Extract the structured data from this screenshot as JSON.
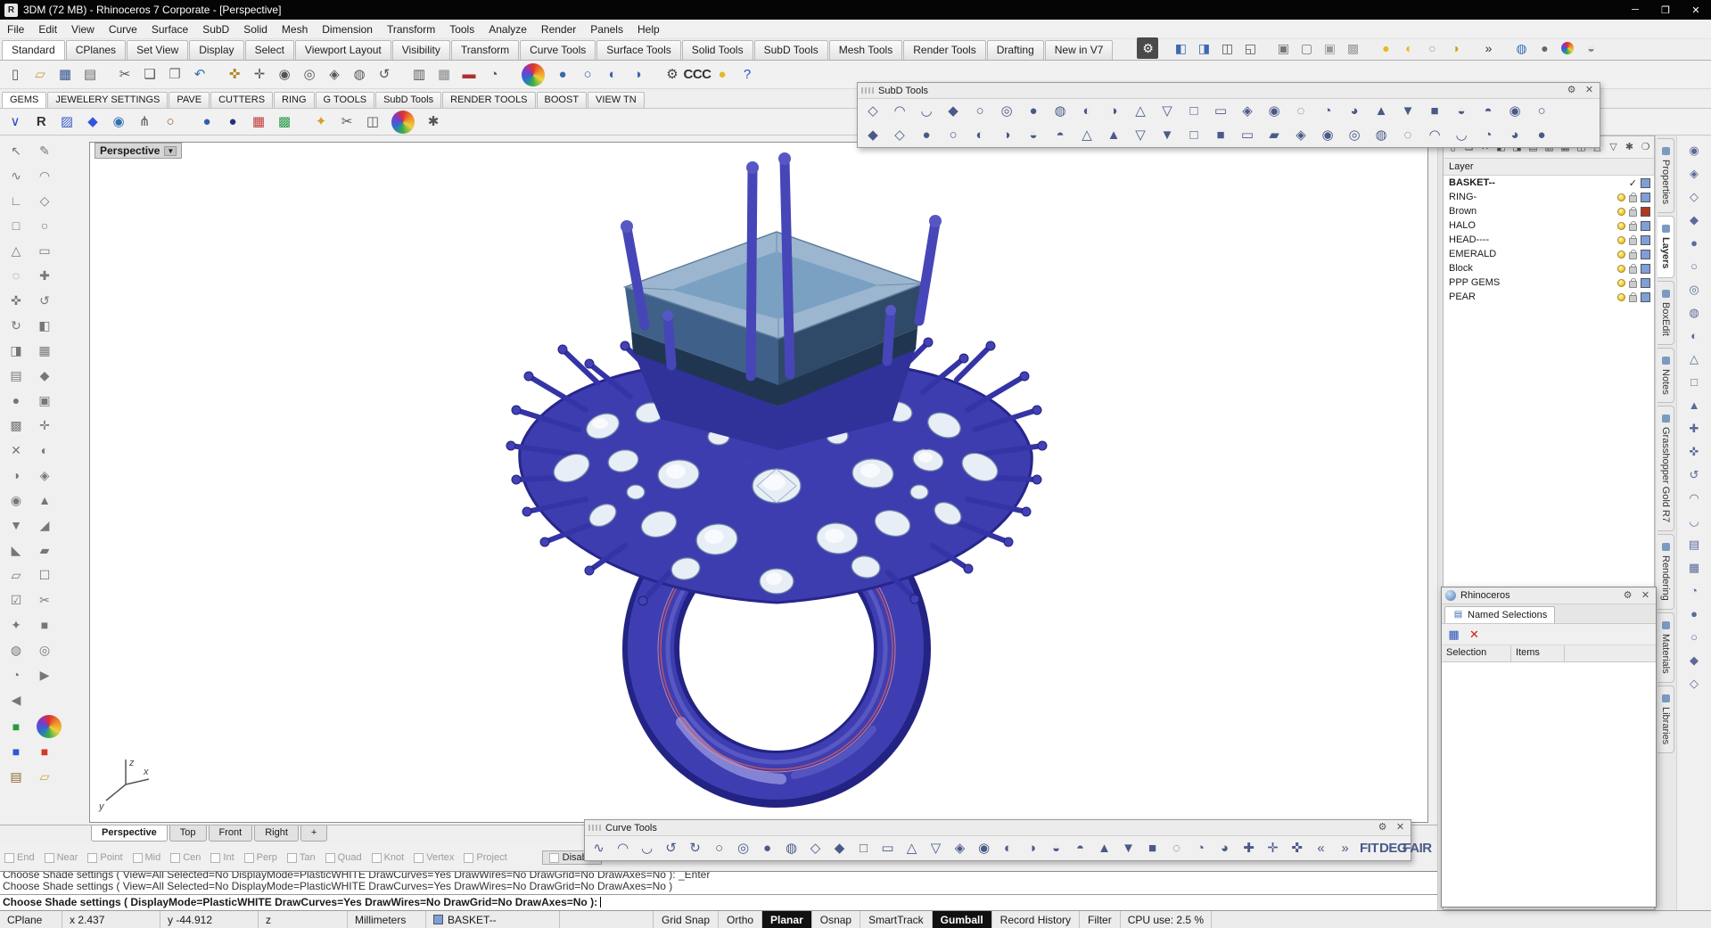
{
  "titlebar": {
    "icon": "R",
    "title": "3DM (72 MB) - Rhinoceros 7 Corporate - [Perspective]",
    "minimize": "─",
    "restore": "❐",
    "close": "✕"
  },
  "menu": {
    "items": [
      "File",
      "Edit",
      "View",
      "Curve",
      "Surface",
      "SubD",
      "Solid",
      "Mesh",
      "Dimension",
      "Transform",
      "Tools",
      "Analyze",
      "Render",
      "Panels",
      "Help"
    ]
  },
  "toolbar_tabs": {
    "items": [
      "Standard",
      "CPlanes",
      "Set View",
      "Display",
      "Select",
      "Viewport Layout",
      "Visibility",
      "Transform",
      "Curve Tools",
      "Surface Tools",
      "Solid Tools",
      "SubD Tools",
      "Mesh Tools",
      "Render Tools",
      "Drafting",
      "New in V7"
    ],
    "active": "Standard"
  },
  "toolbar_tab_icons": [
    {
      "n": "toolbar-options-gear",
      "g": "⚙",
      "cls": "dark"
    },
    {
      "sp": true
    },
    {
      "n": "panel-toggle-left",
      "g": "◧",
      "c": "#3a6ab0"
    },
    {
      "n": "panel-toggle-right",
      "g": "◨",
      "c": "#3a6ab0"
    },
    {
      "n": "screen-layout",
      "g": "◫",
      "c": "#555555"
    },
    {
      "n": "split-view",
      "g": "◱",
      "c": "#555555"
    },
    {
      "sp": true
    },
    {
      "n": "lock-objects",
      "g": "▣",
      "c": "#777777"
    },
    {
      "n": "unlock-objects",
      "g": "▢",
      "c": "#777777"
    },
    {
      "n": "lock-selected",
      "g": "▣",
      "c": "#9a9a9a"
    },
    {
      "n": "unlock-selected",
      "g": "▩",
      "c": "#9a9a9a"
    },
    {
      "sp": true
    },
    {
      "n": "lightbulb-on",
      "g": "●",
      "c": "#e8b820"
    },
    {
      "n": "lightbulb-half",
      "g": "◐",
      "c": "#e8b820"
    },
    {
      "n": "lightbulb-off",
      "g": "○",
      "c": "#999999"
    },
    {
      "n": "lightbulb-dim",
      "g": "◑",
      "c": "#c8a020"
    },
    {
      "sp": true
    },
    {
      "n": "chevron-more",
      "g": "»",
      "c": "#333333"
    },
    {
      "sp": true
    },
    {
      "n": "web-browser-globe",
      "g": "◍",
      "c": "#2e6fb2"
    },
    {
      "n": "shaded-sphere",
      "g": "●",
      "c": "#666666"
    },
    {
      "n": "render-sphere",
      "cls": "rainbow"
    },
    {
      "n": "tech-sphere",
      "g": "◒",
      "c": "#888888"
    }
  ],
  "standard_icons": [
    {
      "n": "new-file",
      "g": "▯",
      "c": "#555555"
    },
    {
      "n": "open-file",
      "g": "▱",
      "c": "#c8a03a"
    },
    {
      "n": "save-file",
      "g": "▦",
      "c": "#33508c"
    },
    {
      "n": "print",
      "g": "▤",
      "c": "#666666"
    },
    {
      "sp": true
    },
    {
      "n": "cut",
      "g": "✂",
      "c": "#555555"
    },
    {
      "n": "copy-clipboard",
      "g": "❏",
      "c": "#555555"
    },
    {
      "n": "paste-clipboard",
      "g": "❐",
      "c": "#777777"
    },
    {
      "n": "undo",
      "g": "↶",
      "c": "#2e6fb2"
    },
    {
      "sp": true
    },
    {
      "n": "pan-hand",
      "g": "✜",
      "c": "#b5882a"
    },
    {
      "n": "move",
      "g": "✛",
      "c": "#555555"
    },
    {
      "n": "zoom-dynamic",
      "g": "◉",
      "c": "#555555"
    },
    {
      "n": "zoom-window",
      "g": "◎",
      "c": "#555555"
    },
    {
      "n": "zoom-extents",
      "g": "◈",
      "c": "#555555"
    },
    {
      "n": "zoom-selected",
      "g": "◍",
      "c": "#555555"
    },
    {
      "n": "undo-view",
      "g": "↺",
      "c": "#555555"
    },
    {
      "sp": true
    },
    {
      "n": "named-cplane",
      "g": "▥",
      "c": "#555555"
    },
    {
      "n": "grid-snap-options",
      "g": "▦",
      "c": "#888888"
    },
    {
      "n": "ortho-marker",
      "g": "▬",
      "c": "#b03030"
    },
    {
      "n": "analyze-direction",
      "g": "◔",
      "c": "#555555"
    },
    {
      "sp": true
    },
    {
      "n": "render-preview",
      "cls": "rainbow"
    },
    {
      "n": "shaded-mode",
      "g": "●",
      "c": "#3b66a8"
    },
    {
      "n": "wireframe-mode",
      "g": "○",
      "c": "#3b66a8"
    },
    {
      "n": "ghosted-mode",
      "g": "◐",
      "c": "#3b66a8"
    },
    {
      "n": "xray-mode",
      "g": "◑",
      "c": "#3b66a8"
    },
    {
      "sp": true
    },
    {
      "n": "gear-options",
      "g": "⚙",
      "c": "#444444"
    },
    {
      "n": "ccc-command",
      "g": "CCC",
      "cls": "txt"
    },
    {
      "n": "lightbulb-tip",
      "g": "●",
      "c": "#e8b820"
    },
    {
      "n": "help",
      "g": "?",
      "c": "#2255cc"
    }
  ],
  "custom_tabs": {
    "items": [
      "GEMS",
      "JEWELERY SETTINGS",
      "PAVE",
      "CUTTERS",
      "RING",
      "G TOOLS",
      "SubD Tools",
      "RENDER TOOLS",
      "BOOST",
      "VIEW TN"
    ],
    "active": "GEMS"
  },
  "jewelry_icons": [
    {
      "n": "gem-profile",
      "g": "∨",
      "c": "#2946cc"
    },
    {
      "n": "royal-tool",
      "g": "R",
      "cls": "txt"
    },
    {
      "n": "pave-gems",
      "g": "▨",
      "c": "#3a5acc"
    },
    {
      "n": "gem-blue",
      "g": "◆",
      "c": "#3355dd"
    },
    {
      "n": "halo-tool",
      "g": "◉",
      "c": "#2e6fb2"
    },
    {
      "n": "prong-tool",
      "g": "⋔",
      "c": "#555555"
    },
    {
      "n": "ring-builder",
      "g": "○",
      "c": "#8a5a20"
    },
    {
      "sp": true
    },
    {
      "n": "sphere-blue",
      "g": "●",
      "c": "#2e5fb0"
    },
    {
      "n": "sphere-navy",
      "g": "●",
      "c": "#22327a"
    },
    {
      "n": "gem-palette",
      "g": "▦",
      "c": "#c23a3a"
    },
    {
      "n": "material-grid",
      "g": "▩",
      "c": "#2a9a4a"
    },
    {
      "sp": true
    },
    {
      "n": "boost-star",
      "g": "✦",
      "c": "#d0a020"
    },
    {
      "n": "cutter-tool",
      "g": "✂",
      "c": "#555555"
    },
    {
      "n": "capture-view",
      "g": "◫",
      "c": "#555555"
    },
    {
      "n": "render-ball",
      "cls": "rainbow"
    },
    {
      "n": "settings-tool",
      "g": "✱",
      "c": "#555555"
    }
  ],
  "subd_palette": {
    "title": "SubD Tools",
    "gear": "⚙",
    "close": "✕",
    "row1": "◇◠◡◆○◎●◍◐◑△▽□▭◈◉◌◔◕▲▼■◒◓◉○",
    "row2": "◆◇●○◐◑◒◓△▲▽▼□■▭▰◈◉◎◍◌◠◡◔◕●"
  },
  "curve_palette": {
    "title": "Curve Tools",
    "gear": "⚙",
    "close": "✕",
    "glyphs": "∿◠◡↺↻○◎●◍◇◆□▭△▽◈◉◐◑◒◓▲▼■◌◔◕✚✛✜«»",
    "extra": [
      {
        "n": "fit-curve",
        "g": "FIT",
        "cls": "txt"
      },
      {
        "n": "change-degree",
        "g": "DEG",
        "cls": "txt"
      },
      {
        "n": "fair-curve",
        "g": "FAIR",
        "cls": "txt"
      }
    ]
  },
  "left_toolbar": {
    "glyphs": "↖✎∿◠∟◇□○△▭◌✚✜↺↻◧◨▦▤◆●▣▩✛✕◐◑◈◉▲▼◢◣▰▱☐☑✂✦■◍◎◔▶◀",
    "colored": [
      {
        "n": "cube-green",
        "g": "■",
        "c": "#2a9a3a"
      },
      {
        "n": "cube-multi",
        "cls": "rainbow"
      },
      {
        "n": "cube-blue",
        "g": "■",
        "c": "#2a5ad0"
      },
      {
        "n": "cube-red",
        "g": "■",
        "c": "#d03a2a"
      },
      {
        "n": "layer-state",
        "g": "▤",
        "c": "#8a6a2a"
      },
      {
        "n": "folder",
        "g": "▱",
        "c": "#caa53a"
      }
    ]
  },
  "viewport": {
    "label": "Perspective",
    "menu_arrow": "▼"
  },
  "axis": {
    "x": "x",
    "y": "y",
    "z": "z"
  },
  "layers_panel": {
    "header": "Layer",
    "tool_glyphs": "▯❏✕◧◨▤▥▦◫△▽✱❍",
    "current_mark": "✓",
    "layers": [
      {
        "name": "BASKET--",
        "current": true,
        "swatch": "#7e9fd8"
      },
      {
        "name": "RING-",
        "swatch": "#7e9fd8"
      },
      {
        "name": "Brown",
        "swatch": "#b03a20"
      },
      {
        "name": "HALO",
        "swatch": "#7e9fd8"
      },
      {
        "name": "HEAD----",
        "swatch": "#7e9fd8"
      },
      {
        "name": "EMERALD",
        "swatch": "#7e9fd8"
      },
      {
        "name": "Block",
        "swatch": "#7e9fd8"
      },
      {
        "name": "PPP GEMS",
        "swatch": "#7e9fd8"
      },
      {
        "name": "PEAR",
        "swatch": "#7e9fd8"
      }
    ]
  },
  "side_tabs": [
    {
      "label": "Properties"
    },
    {
      "label": "Layers",
      "active": true
    },
    {
      "label": "BoxEdit"
    },
    {
      "label": "Notes"
    },
    {
      "label": "Grasshopper Gold R7"
    },
    {
      "label": "Rendering"
    },
    {
      "label": "Materials"
    },
    {
      "label": "Libraries"
    }
  ],
  "edge_glyphs": "◉◈◇◆●○◎◍◐△□▲✚✜↺◠◡▤▦◔●○◆◇",
  "ns_panel": {
    "title": "Rhinoceros",
    "gear": "⚙",
    "close": "✕",
    "tab": "Named Selections",
    "tab_icon": "▤",
    "save_icon": "▦",
    "delete_icon": "✕",
    "columns": [
      "Selection",
      "Items"
    ]
  },
  "viewport_tabs": {
    "items": [
      {
        "label": "Perspective",
        "active": true
      },
      {
        "label": "Top"
      },
      {
        "label": "Front"
      },
      {
        "label": "Right"
      },
      {
        "label": "+"
      }
    ]
  },
  "osnap": {
    "items": [
      "End",
      "Near",
      "Point",
      "Mid",
      "Cen",
      "Int",
      "Perp",
      "Tan",
      "Quad",
      "Knot",
      "Vertex",
      "Project"
    ],
    "disable_label": "Disable"
  },
  "command": {
    "history1": "Choose Shade settings ( View=All  Selected=No  DisplayMode=PlasticWHITE  DrawCurves=Yes  DrawWires=No  DrawGrid=No  DrawAxes=No ): _Enter",
    "history2": "Choose Shade settings ( View=All  Selected=No  DisplayMode=PlasticWHITE  DrawCurves=Yes  DrawWires=No  DrawGrid=No  DrawAxes=No )",
    "prompt": "Choose Shade settings ( DisplayMode=PlasticWHITE  DrawCurves=Yes  DrawWires=No  DrawGrid=No  DrawAxes=No ):"
  },
  "status_bar": {
    "cplane": "CPlane",
    "x": "x 2.437",
    "y": "y -44.912",
    "z": "z",
    "units": "Millimeters",
    "layer": "BASKET--",
    "layer_swatch": "#7e9fd8",
    "toggles": [
      {
        "label": "Grid Snap"
      },
      {
        "label": "Ortho"
      },
      {
        "label": "Planar",
        "active": true
      },
      {
        "label": "Osnap"
      },
      {
        "label": "SmartTrack"
      },
      {
        "label": "Gumball",
        "active": true
      },
      {
        "label": "Record History"
      },
      {
        "label": "Filter"
      }
    ],
    "cpu": "CPU use: 2.5 %"
  }
}
